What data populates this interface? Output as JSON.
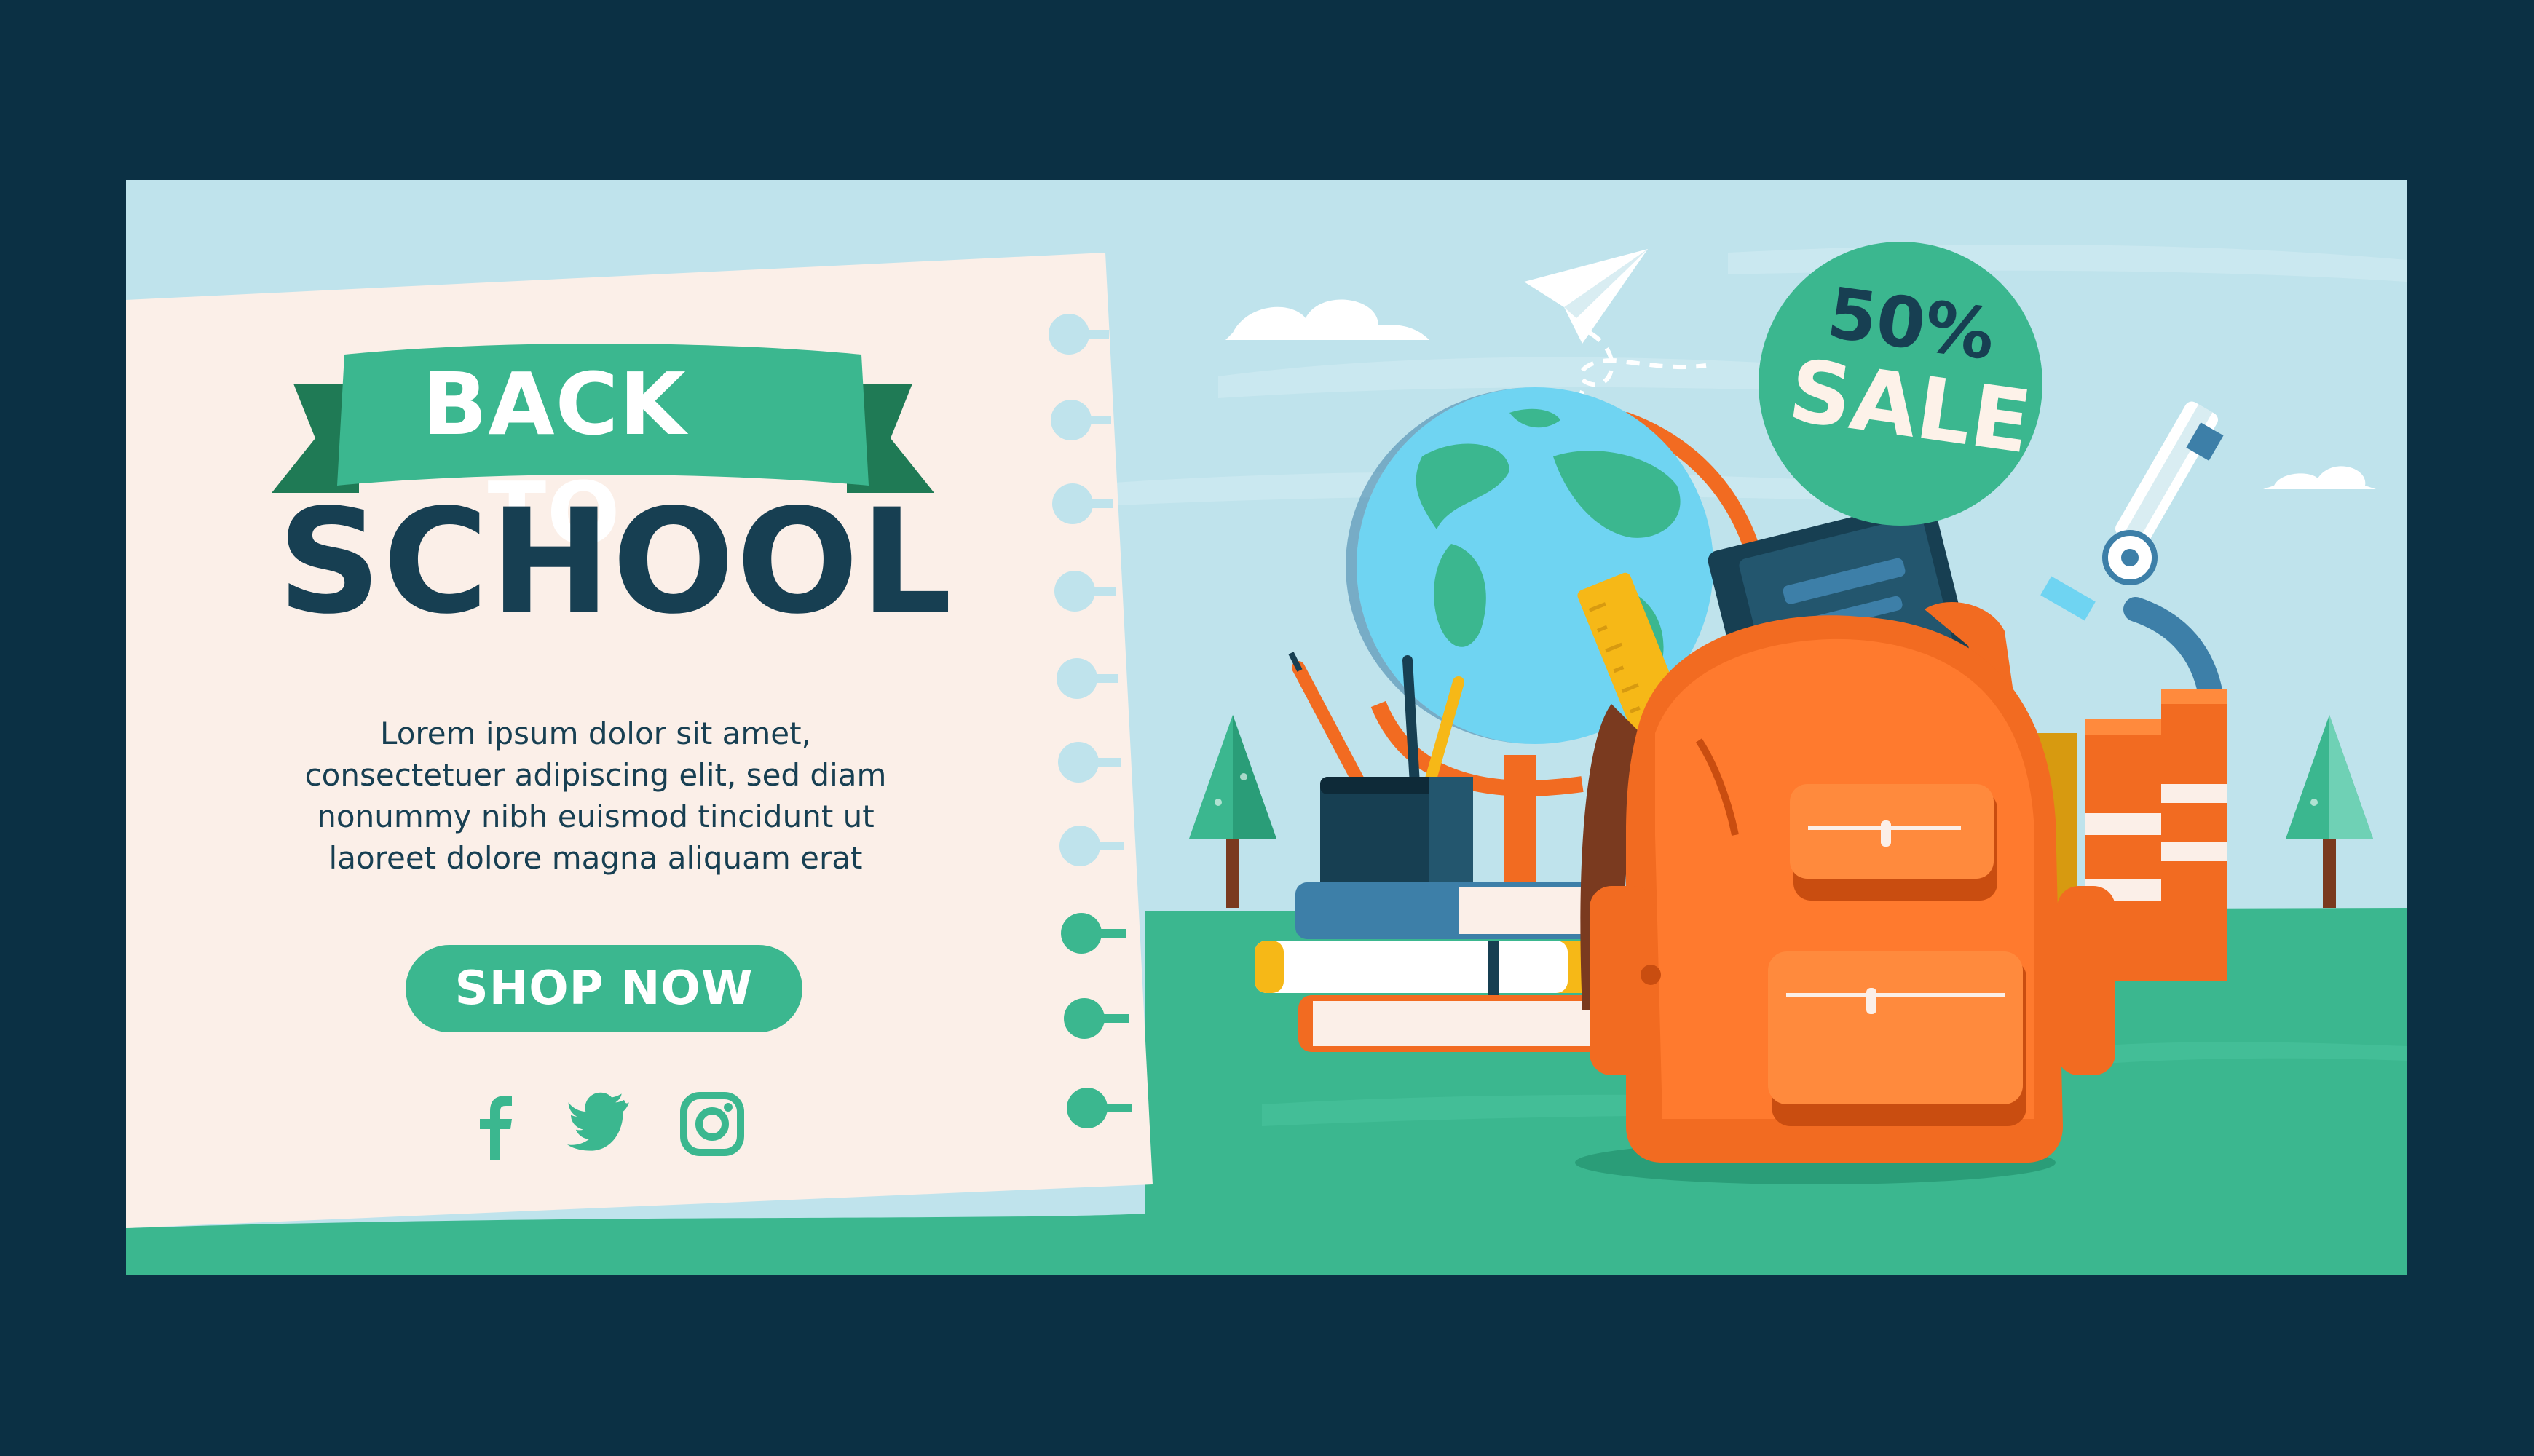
{
  "banner": {
    "ribbon_title": "BACK TO",
    "main_title": "SCHOOL",
    "body_lines": [
      "Lorem ipsum dolor sit amet,",
      "consectetuer adipiscing elit, sed diam",
      "nonummy nibh euismod tincidunt ut",
      "laoreet dolore magna aliquam erat"
    ],
    "cta_label": "SHOP NOW",
    "social_icons": [
      "facebook-icon",
      "twitter-icon",
      "instagram-icon"
    ],
    "sale": {
      "percent": "50%",
      "word": "SALE"
    }
  },
  "colors": {
    "background": "#0b3044",
    "sky": "#bfe3ec",
    "paper": "#fbefe8",
    "grass": "#3bb78f",
    "grass_dark": "#2a9d78",
    "ribbon": "#3bb78f",
    "ribbon_dark": "#1f7a55",
    "title": "#173f52",
    "backpack": "#f26b21",
    "backpack_light": "#ff8a3d",
    "book_yellow": "#f6b817",
    "book_blue": "#3d7fa8"
  }
}
